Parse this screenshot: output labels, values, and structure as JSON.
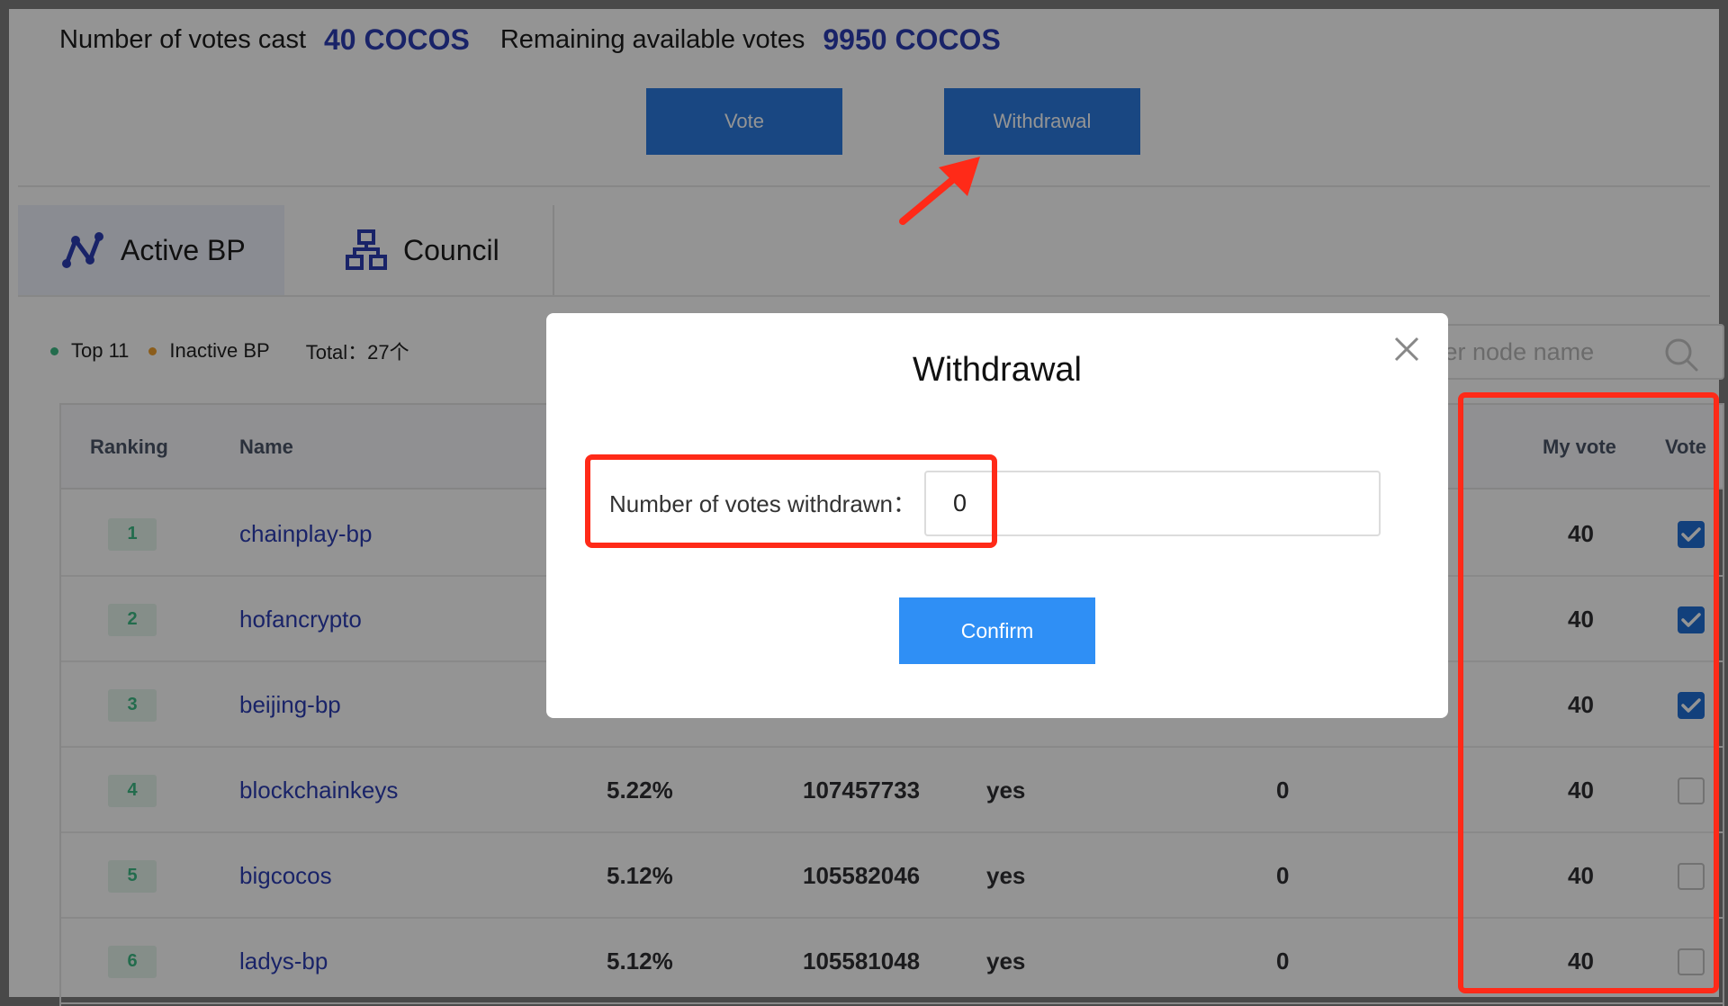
{
  "header": {
    "votes_cast_label": "Number of votes cast",
    "votes_cast_value": "40 COCOS",
    "remaining_label": "Remaining available votes",
    "remaining_value": "9950 COCOS",
    "vote_button": "Vote",
    "withdrawal_button": "Withdrawal"
  },
  "tabs": [
    {
      "label": "Active BP",
      "icon": "active-bp-icon",
      "active": true
    },
    {
      "label": "Council",
      "icon": "council-icon",
      "active": false
    }
  ],
  "filters": {
    "top_label": "Top 11",
    "inactive_label": "Inactive BP",
    "total_label": "Total：27个",
    "search_placeholder": "nter node name"
  },
  "table": {
    "columns": {
      "ranking": "Ranking",
      "name": "Name",
      "my_vote": "My vote",
      "vote": "Vote"
    },
    "rows": [
      {
        "rank": "1",
        "name": "chainplay-bp",
        "percent": "",
        "votes": "",
        "active": "",
        "extra": "",
        "my_vote": "40",
        "checked": true
      },
      {
        "rank": "2",
        "name": "hofancrypto",
        "percent": "",
        "votes": "",
        "active": "",
        "extra": "",
        "my_vote": "40",
        "checked": true
      },
      {
        "rank": "3",
        "name": "beijing-bp",
        "percent": "",
        "votes": "",
        "active": "",
        "extra": "",
        "my_vote": "40",
        "checked": true
      },
      {
        "rank": "4",
        "name": "blockchainkeys",
        "percent": "5.22%",
        "votes": "107457733",
        "active": "yes",
        "extra": "0",
        "my_vote": "40",
        "checked": false
      },
      {
        "rank": "5",
        "name": "bigcocos",
        "percent": "5.12%",
        "votes": "105582046",
        "active": "yes",
        "extra": "0",
        "my_vote": "40",
        "checked": false
      },
      {
        "rank": "6",
        "name": "ladys-bp",
        "percent": "5.12%",
        "votes": "105581048",
        "active": "yes",
        "extra": "0",
        "my_vote": "40",
        "checked": false
      }
    ]
  },
  "dialog": {
    "title": "Withdrawal",
    "field_label": "Number of votes withdrawn：",
    "field_value": "0",
    "confirm_button": "Confirm"
  },
  "colors": {
    "accent": "#2b7be0",
    "annotation": "#ff2a18",
    "value_blue": "#2c3db3",
    "rank_green": "#3dbb85"
  }
}
